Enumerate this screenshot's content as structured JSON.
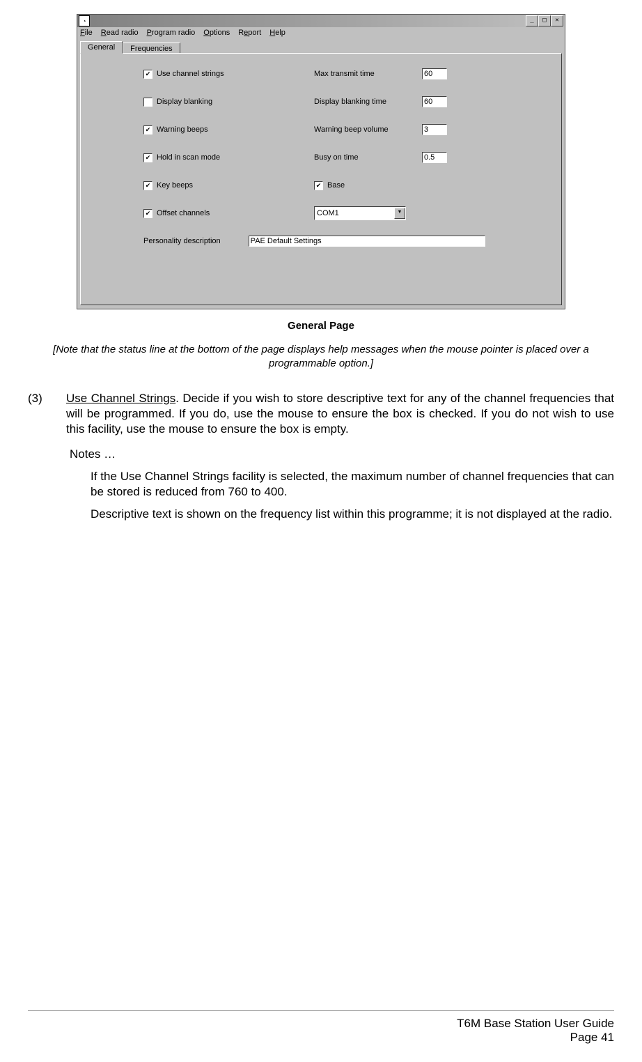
{
  "window": {
    "menubar": [
      "File",
      "Read radio",
      "Program radio",
      "Options",
      "Report",
      "Help"
    ],
    "tabs": {
      "general": "General",
      "frequencies": "Frequencies"
    },
    "checkboxes": {
      "use_channel_strings": {
        "label": "Use channel strings",
        "checked": true
      },
      "display_blanking": {
        "label": "Display blanking",
        "checked": false
      },
      "warning_beeps": {
        "label": "Warning beeps",
        "checked": true
      },
      "hold_scan": {
        "label": "Hold in scan mode",
        "checked": true
      },
      "key_beeps": {
        "label": "Key beeps",
        "checked": true
      },
      "offset_channels": {
        "label": "Offset channels",
        "checked": true
      },
      "base": {
        "label": "Base",
        "checked": true
      }
    },
    "fields": {
      "max_transmit": {
        "label": "Max transmit time",
        "value": "60"
      },
      "display_blanking_time": {
        "label": "Display blanking time",
        "value": "60"
      },
      "warning_beep_volume": {
        "label": "Warning beep volume",
        "value": "3"
      },
      "busy_on_time": {
        "label": "Busy on time",
        "value": "0.5"
      },
      "com_port": {
        "value": "COM1"
      },
      "personality": {
        "label": "Personality description",
        "value": "PAE Default Settings"
      }
    }
  },
  "caption": "General Page",
  "note": "[Note that the status line at the bottom of the page displays help messages when the mouse pointer is placed over a programmable option.]",
  "item": {
    "number": "(3)",
    "term": "Use Channel Strings",
    "text_after": ".  Decide if you wish to store descriptive text for any of the channel frequencies that will be programmed. If you do, use the mouse to ensure the box is checked. If you do not wish to use this facility, use the mouse to ensure the box is empty."
  },
  "notes_label": "Notes …",
  "note1": "If the Use Channel Strings facility is selected, the maximum number of channel frequencies that can be stored is reduced from 760 to 400.",
  "note2": "Descriptive text is shown on the frequency list within this programme; it is not displayed at the radio.",
  "footer": {
    "line1": "T6M Base Station User Guide",
    "line2": "Page 41"
  }
}
